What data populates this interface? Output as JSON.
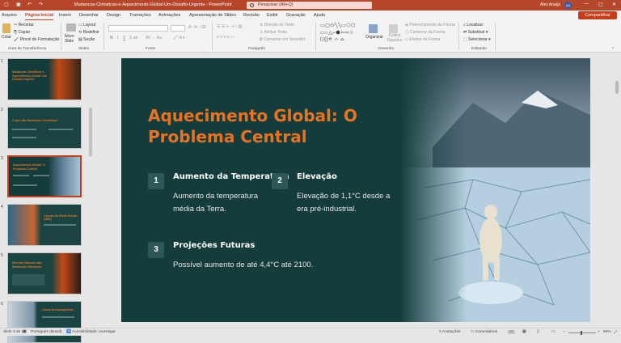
{
  "titlebar": {
    "doc_title": "Mudancas-Climaticas-e-Aquecimento-Global-Um-Desafio-Urgente  -  PowerPoint",
    "search_placeholder": "Pesquisar (Alt+Q)",
    "user_name": "Alex Araújo",
    "user_initials": "AA"
  },
  "tabs": [
    "Arquivo",
    "Página Inicial",
    "Inserir",
    "Desenhar",
    "Design",
    "Transições",
    "Animações",
    "Apresentação de Slides",
    "Revisão",
    "Exibir",
    "Gravação",
    "Ajuda"
  ],
  "share_label": "Compartilhar",
  "ribbon": {
    "paste": "Colar",
    "cut": "Recortar",
    "copy": "Copiar",
    "format_painter": "Pincel de Formatação",
    "new_slide": "Novo Slide",
    "layout": "Layout",
    "reset": "Redefinir",
    "section": "Seção",
    "text_direction": "Direção do Texto",
    "align_text": "Alinhar Texto",
    "smartart": "Converter em SmartArt",
    "arrange": "Organizar",
    "quick_styles": "Estilos Rápidos",
    "shape_fill": "Preenchimento da Forma",
    "shape_outline": "Contorno da Forma",
    "shape_effects": "Efeitos de Forma",
    "find": "Localizar",
    "replace": "Substituir",
    "select": "Selecionar",
    "groups": {
      "clipboard": "Área de Transferência",
      "slides": "Slides",
      "font": "Fonte",
      "paragraph": "Parágrafo",
      "drawing": "Desenho",
      "editing": "Editando"
    }
  },
  "thumbnails": [
    {
      "num": "1",
      "title": "Mudanças Climáticas e Aquecimento Global: Um Desafio Urgente",
      "bg": "#133c3a"
    },
    {
      "num": "2",
      "title": "O que são Mudanças Climáticas?",
      "bg": "#1a4442"
    },
    {
      "num": "3",
      "title": "Aquecimento Global: O Problema Central",
      "bg": "#133c3a"
    },
    {
      "num": "4",
      "title": "Causas do Efeito Estufa (GEE)",
      "bg": "#1a4442"
    },
    {
      "num": "5",
      "title": "Eventos Naturais das Mudanças Climáticas",
      "bg": "#1a4442"
    },
    {
      "num": "6",
      "title": "Causa Antropogênicas",
      "bg": "#1a4442"
    }
  ],
  "slide": {
    "title": "Aquecimento Global: O Problema Central",
    "items": [
      {
        "num": "1",
        "heading": "Aumento da Temperatura",
        "body": "Aumento da temperatura média da Terra."
      },
      {
        "num": "2",
        "heading": "Elevação",
        "body": "Elevação de 1,1°C desde a era pré-industrial."
      },
      {
        "num": "3",
        "heading": "Projeções Futuras",
        "body": "Possível aumento de até 4,4°C até 2100."
      }
    ]
  },
  "status": {
    "slide_count": "Slide 3 de 20",
    "language": "Português (Brasil)",
    "accessibility": "Acessibilidade: investigar",
    "notes": "Anotações",
    "comments": "Comentários",
    "zoom": "94%"
  },
  "colors": {
    "accent": "#b7472a",
    "slide_bg": "#133c3a",
    "title_orange": "#e87325"
  }
}
